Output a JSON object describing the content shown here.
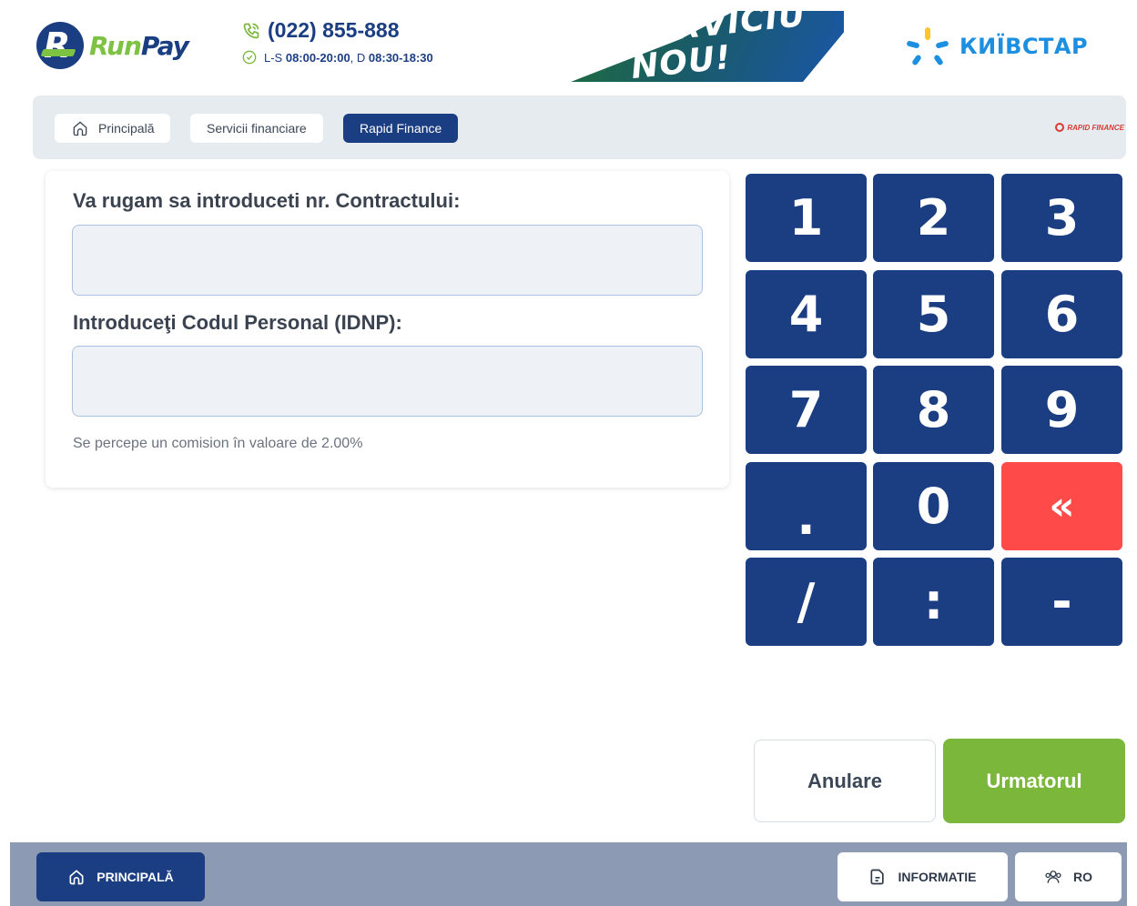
{
  "header": {
    "logo": {
      "run": "Run",
      "pay": "Pay"
    },
    "phone": "(022) 855-888",
    "hours_prefix": "L-S ",
    "hours_weekday": "08:00-20:00",
    "hours_mid": ", D ",
    "hours_sunday": "08:30-18:30",
    "banner_line1": "SERVICIU",
    "banner_line2": "NOU!",
    "partner": "КИЇВСТАР"
  },
  "breadcrumb": {
    "items": [
      {
        "label": "Principală",
        "icon": "home-icon"
      },
      {
        "label": "Servicii financiare"
      },
      {
        "label": "Rapid Finance",
        "active": true
      }
    ],
    "provider_logo": "RAPID FINANCE"
  },
  "form": {
    "contract_label": "Va rugam sa introduceti nr. Contractului:",
    "contract_value": "",
    "idnp_label": "Introduceţi Codul Personal (IDNP):",
    "idnp_value": "",
    "commission_note": "Se percepe un comision în valoare de 2.00%"
  },
  "keypad": {
    "keys": [
      "1",
      "2",
      "3",
      "4",
      "5",
      "6",
      "7",
      "8",
      "9",
      ".",
      "0",
      "«",
      "/",
      ":",
      "-"
    ]
  },
  "actions": {
    "cancel": "Anulare",
    "next": "Urmatorul"
  },
  "footer": {
    "home": "PRINCIPALĂ",
    "info": "INFORMATIE",
    "lang": "RO"
  },
  "colors": {
    "primary": "#1b3d82",
    "accent_green": "#7ab73a",
    "backspace_red": "#ff4a4a",
    "footer_bg": "#8c9ab3"
  }
}
